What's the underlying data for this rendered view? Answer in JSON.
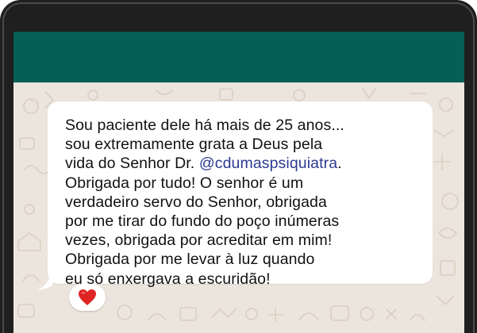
{
  "message": {
    "text_part1": "Sou paciente dele há mais de 25 anos...\nsou extremamente grata a Deus pela\nvida do Senhor Dr. ",
    "mention": "@cdumaspsiquiatra",
    "text_part2": ".\nObrigada por tudo! O senhor é um\nverdadeiro servo do Senhor, obrigada\npor me tirar do fundo do poço inúmeras\nvezes, obrigada por acreditar em mim!\nObrigada por me levar à luz quando\neu só enxergava a escuridão!"
  },
  "reaction": {
    "emoji_icon": "heart-icon"
  },
  "colors": {
    "header": "#075e54",
    "chat_background": "#ece5dd",
    "bubble": "#ffffff",
    "mention": "#2b3a8f",
    "heart": "#e02424"
  }
}
